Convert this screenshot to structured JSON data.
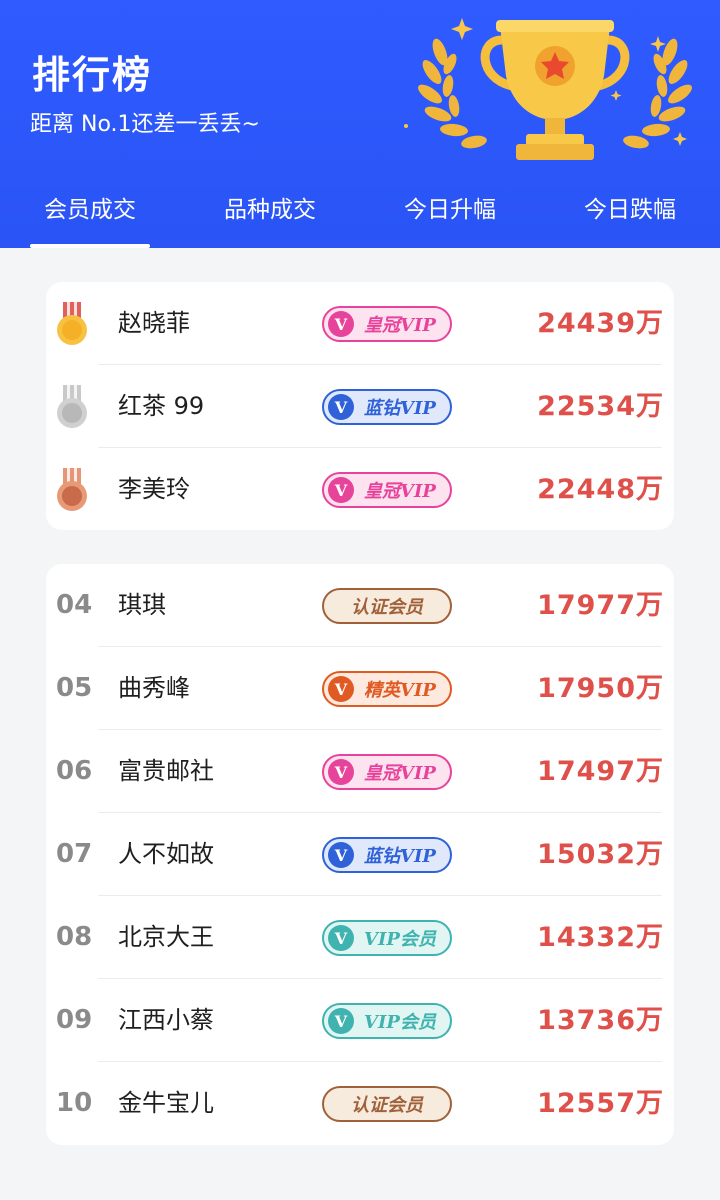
{
  "header": {
    "title": "排行榜",
    "subtitle": "距离 No.1还差一丢丢~"
  },
  "tabs": [
    {
      "label": "会员成交",
      "active": true
    },
    {
      "label": "品种成交",
      "active": false
    },
    {
      "label": "今日升幅",
      "active": false
    },
    {
      "label": "今日跌幅",
      "active": false
    }
  ],
  "colors": {
    "header_blue": "#2f5bff",
    "amount_red": "#e0504a",
    "badge_crown": "#e8439a",
    "badge_blue_diamond": "#2f62d8",
    "badge_elite": "#e05a24",
    "badge_vip": "#3fb3b0",
    "badge_certified": "#a0613a"
  },
  "top3": [
    {
      "medal": "gold-medal-icon",
      "name": "赵晓菲",
      "badge": "皇冠VIP",
      "badge_type": "crown",
      "amount": "24439万"
    },
    {
      "medal": "silver-medal-icon",
      "name": "红茶 99",
      "badge": "蓝钻VIP",
      "badge_type": "blue",
      "amount": "22534万"
    },
    {
      "medal": "bronze-medal-icon",
      "name": "李美玲",
      "badge": "皇冠VIP",
      "badge_type": "crown",
      "amount": "22448万"
    }
  ],
  "others": [
    {
      "rank": "04",
      "name": "琪琪",
      "badge": "认证会员",
      "badge_type": "cert",
      "amount": "17977万"
    },
    {
      "rank": "05",
      "name": "曲秀峰",
      "badge": "精英VIP",
      "badge_type": "elite",
      "amount": "17950万"
    },
    {
      "rank": "06",
      "name": "富贵邮社",
      "badge": "皇冠VIP",
      "badge_type": "crown",
      "amount": "17497万"
    },
    {
      "rank": "07",
      "name": "人不如故",
      "badge": "蓝钻VIP",
      "badge_type": "blue",
      "amount": "15032万"
    },
    {
      "rank": "08",
      "name": "北京大王",
      "badge": "VIP会员",
      "badge_type": "vip",
      "amount": "14332万"
    },
    {
      "rank": "09",
      "name": "江西小蔡",
      "badge": "VIP会员",
      "badge_type": "vip",
      "amount": "13736万"
    },
    {
      "rank": "10",
      "name": "金牛宝儿",
      "badge": "认证会员",
      "badge_type": "cert",
      "amount": "12557万"
    }
  ]
}
